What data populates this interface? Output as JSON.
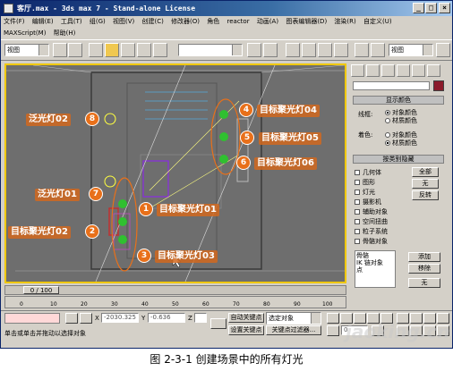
{
  "window": {
    "title": "客厅.max - 3ds max 7  - Stand-alone License",
    "min": "_",
    "max": "□",
    "close": "×"
  },
  "menu": {
    "items": [
      "文件(F)",
      "编辑(E)",
      "工具(T)",
      "组(G)",
      "视图(V)",
      "创建(C)",
      "修改器(O)",
      "角色",
      "reactor",
      "动画(A)",
      "图表编辑器(D)",
      "渲染(R)",
      "自定义(U)"
    ],
    "items2": [
      "MAXScript(M)",
      "帮助(H)"
    ]
  },
  "toolbar": {
    "view_select": "视图",
    "named_sel": "",
    "view_select2": "视图"
  },
  "viewport": {
    "callouts": [
      {
        "num": "8",
        "label": "泛光灯02"
      },
      {
        "num": "7",
        "label": "泛光灯01"
      },
      {
        "num": "2",
        "label": "目标聚光灯02"
      },
      {
        "num": "1",
        "label": "目标聚光灯01"
      },
      {
        "num": "3",
        "label": "目标聚光灯03"
      },
      {
        "num": "4",
        "label": "目标聚光灯04"
      },
      {
        "num": "5",
        "label": "目标聚光灯05"
      },
      {
        "num": "6",
        "label": "目标聚光灯06"
      }
    ]
  },
  "command_panel": {
    "display_color_header": "显示颜色",
    "wireframe_label": "线框:",
    "shaded_label": "着色:",
    "opt_object_color": "对象颜色",
    "opt_material_color": "材质颜色",
    "hide_by_category_header": "按类别隐藏",
    "categories": [
      "几何体",
      "图形",
      "灯光",
      "摄影机",
      "辅助对象",
      "空间扭曲",
      "粒子系统",
      "骨骼对象"
    ],
    "btn_all": "全部",
    "btn_none": "无",
    "btn_invert": "反转",
    "list_items": [
      "骨骼",
      "IK 链对象",
      "点"
    ],
    "btn_add": "添加",
    "btn_remove": "移除",
    "btn_none2": "无"
  },
  "timeline": {
    "frame": "0 / 100",
    "ticks": [
      "0",
      "10",
      "20",
      "30",
      "40",
      "50",
      "60",
      "70",
      "80",
      "90",
      "100"
    ]
  },
  "status": {
    "x_label": "X",
    "x_value": "-2030.325",
    "y_label": "Y",
    "y_value": "-0.636",
    "z_label": "Z",
    "z_value": "",
    "auto_key": "自动关键点",
    "set_key": "设置关键点",
    "selection_set": "选定对象",
    "key_filters": "关键点过滤器...",
    "prompt": "单击或单击并拖动以选择对象",
    "frame_value": "0"
  },
  "caption": "图 2-3-1   创建场景中的所有灯光",
  "watermark": "jaoking.cn",
  "colors": {
    "accent_orange": "#e8701a",
    "viewport_bg": "#6e6e6e",
    "viewport_border": "#f0c800"
  }
}
